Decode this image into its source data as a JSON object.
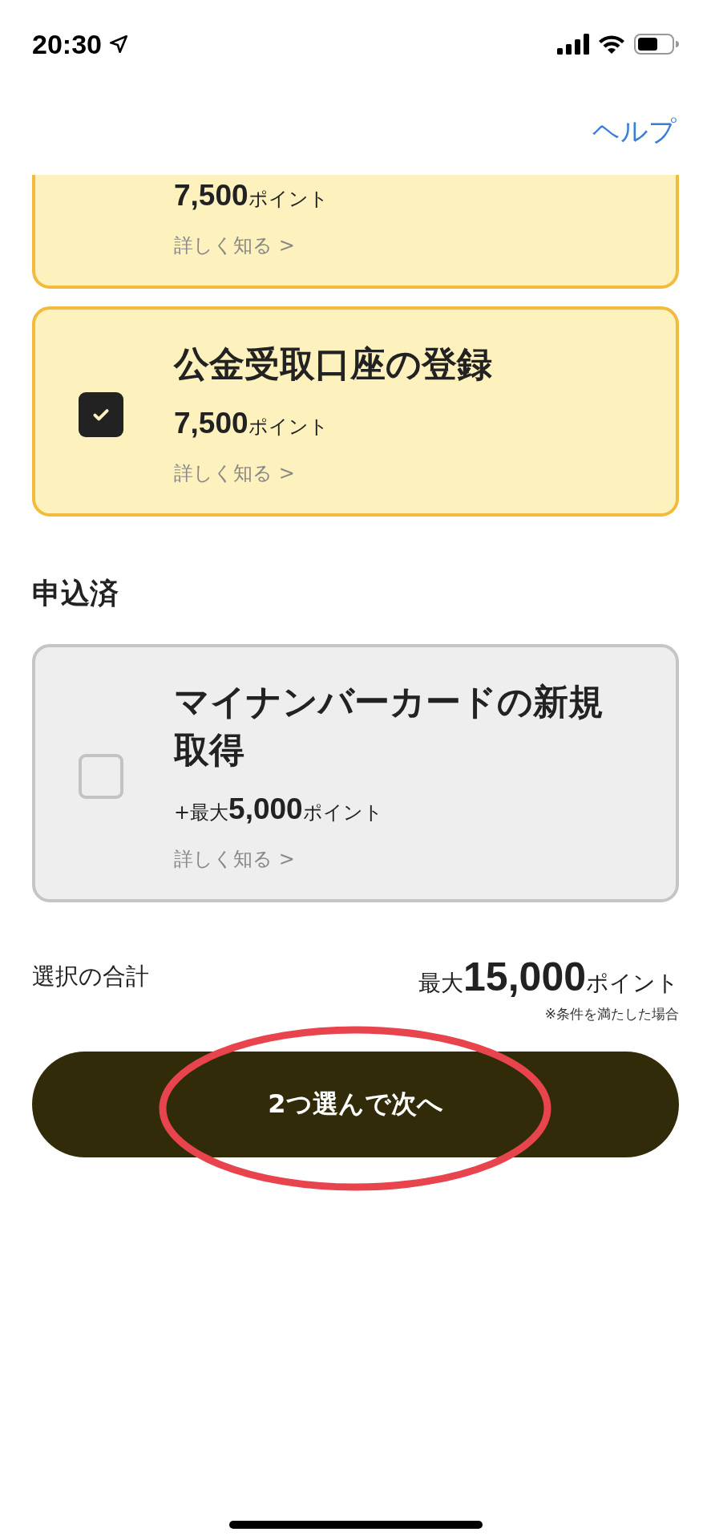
{
  "status_bar": {
    "time": "20:30"
  },
  "header": {
    "help": "ヘルプ"
  },
  "selectable_cards": [
    {
      "points": {
        "amount": "7,500",
        "unit": "ポイント"
      },
      "link": "詳しく知る >",
      "selected": true,
      "clipped": true
    },
    {
      "title": "公金受取口座の登録",
      "points": {
        "amount": "7,500",
        "unit": "ポイント"
      },
      "link": "詳しく知る >",
      "selected": true,
      "checked": true
    }
  ],
  "applied_section": {
    "heading": "申込済",
    "cards": [
      {
        "title": "マイナンバーカードの新規取得",
        "points": {
          "prefix": "+最大",
          "amount": "5,000",
          "unit": "ポイント"
        },
        "link": "詳しく知る >",
        "selected": false,
        "checked": false
      }
    ]
  },
  "total": {
    "label": "選択の合計",
    "prefix": "最大",
    "amount": "15,000",
    "unit": "ポイント",
    "note": "※条件を満たした場合"
  },
  "next_button": {
    "label": "2つ選んで次へ"
  }
}
